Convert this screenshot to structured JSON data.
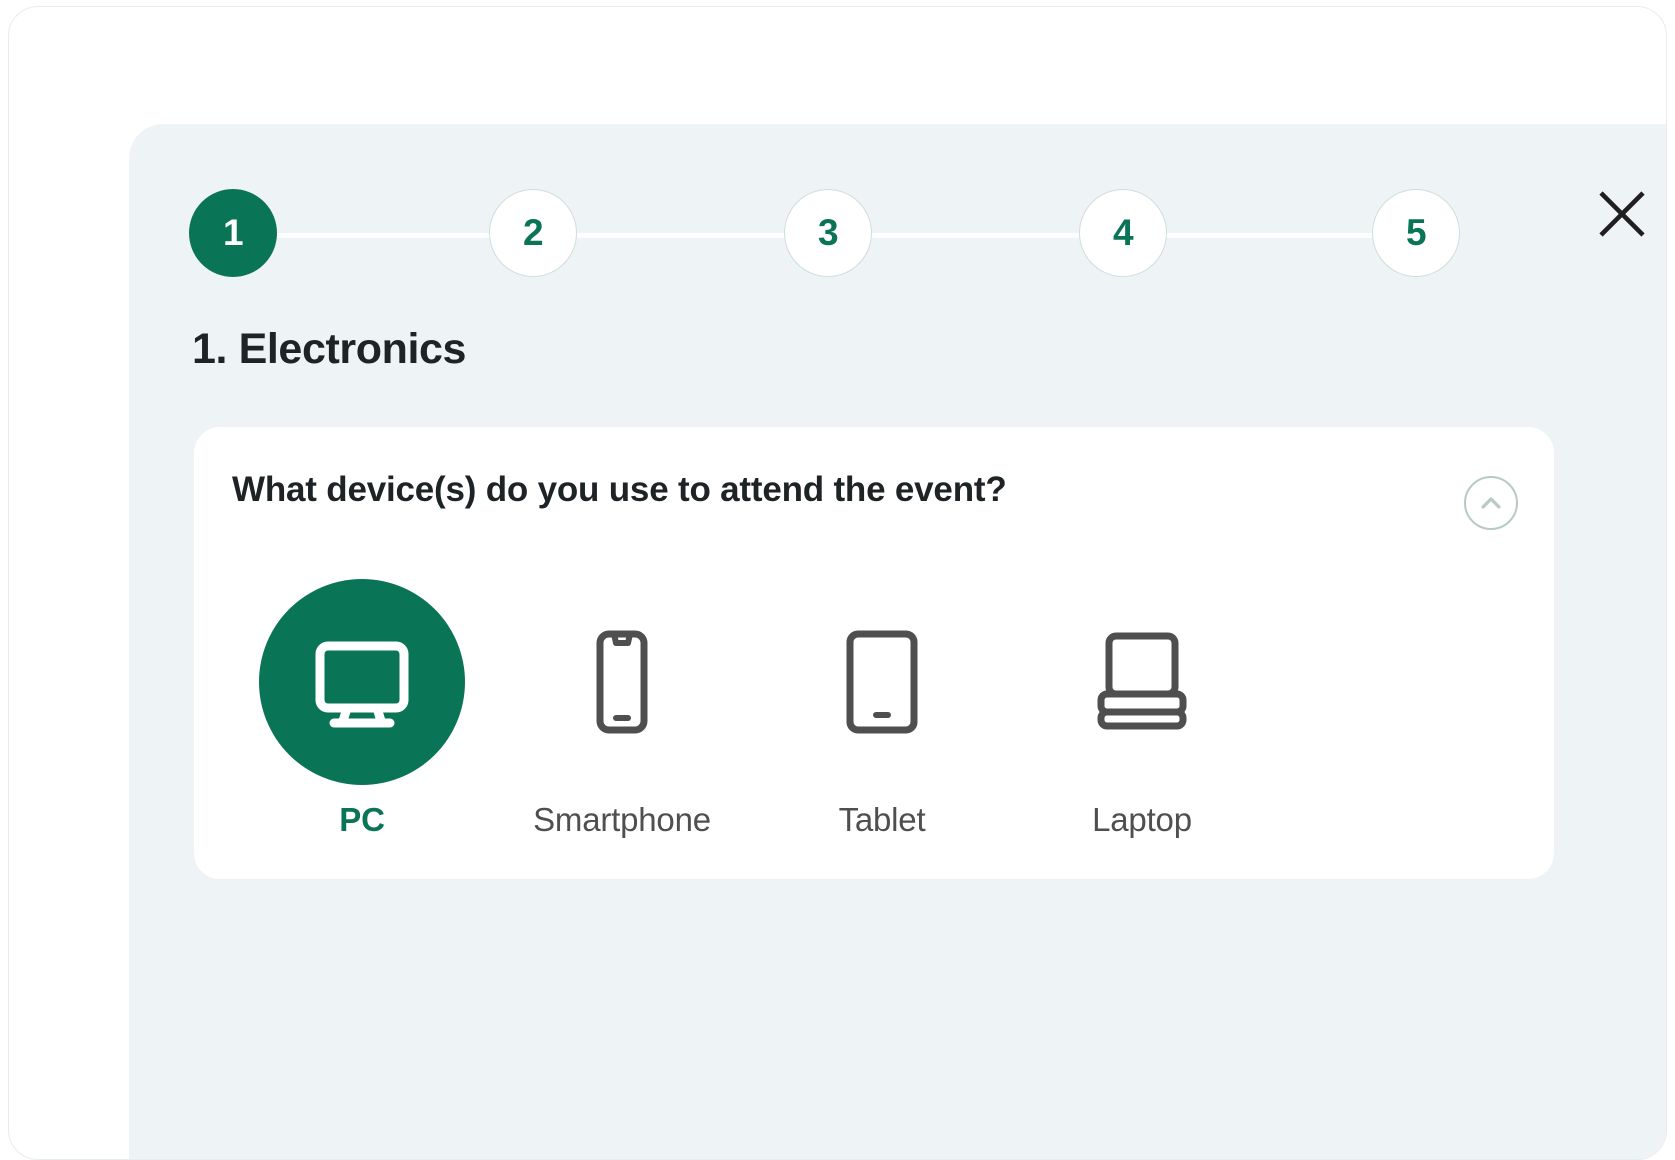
{
  "stepper": {
    "steps": [
      {
        "label": "1",
        "state": "active"
      },
      {
        "label": "2",
        "state": "inactive"
      },
      {
        "label": "3",
        "state": "inactive"
      },
      {
        "label": "4",
        "state": "inactive"
      },
      {
        "label": "5",
        "state": "inactive"
      }
    ],
    "active_color": "#0a7556",
    "inactive_border_color": "#cfdedb",
    "track_color": "#fdfefe"
  },
  "close_button": {
    "icon": "close-x-icon",
    "color": "#1f1f1f"
  },
  "section": {
    "title": "1. Electronics"
  },
  "question_card": {
    "question": "What device(s) do you use to attend the event?",
    "collapse_icon": "chevron-up-icon",
    "collapse_icon_color": "#b7cac4",
    "options": [
      {
        "label": "PC",
        "icon": "monitor-icon",
        "selected": true
      },
      {
        "label": "Smartphone",
        "icon": "smartphone-icon",
        "selected": false
      },
      {
        "label": "Tablet",
        "icon": "tablet-icon",
        "selected": false
      },
      {
        "label": "Laptop",
        "icon": "laptop-icon",
        "selected": false
      }
    ],
    "icon_color": "#4f4f4f",
    "selected_color": "#0a7556",
    "card_background": "#ffffff"
  },
  "theme": {
    "panel_background": "#eef3f5",
    "page_background": "#ffffff",
    "text_color": "#1e2326"
  }
}
